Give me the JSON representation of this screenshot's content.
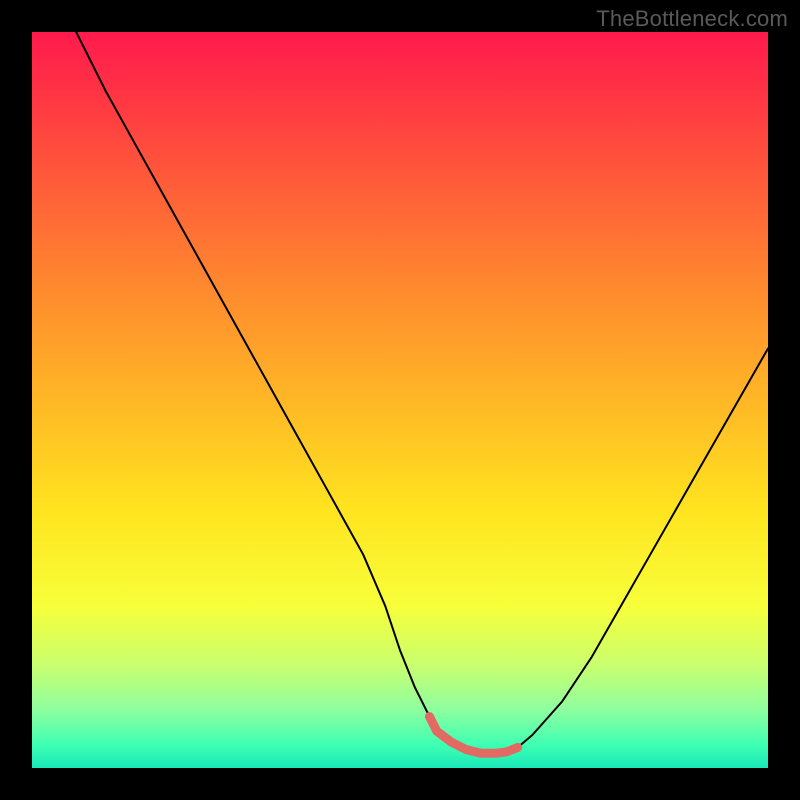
{
  "watermark": "TheBottleneck.com",
  "chart_data": {
    "type": "line",
    "title": "",
    "xlabel": "",
    "ylabel": "",
    "xlim": [
      0,
      100
    ],
    "ylim": [
      0,
      100
    ],
    "series": [
      {
        "name": "main-curve",
        "color": "#000000",
        "x": [
          6,
          10,
          15,
          20,
          25,
          30,
          35,
          40,
          45,
          48,
          50,
          52,
          54,
          55,
          57,
          59,
          61,
          63,
          64.5,
          66,
          68,
          72,
          76,
          80,
          84,
          88,
          92,
          96,
          100
        ],
        "values": [
          100,
          92,
          83,
          74,
          65,
          56,
          47,
          38,
          29,
          22,
          16,
          11,
          7,
          5,
          3.5,
          2.5,
          2,
          2,
          2.2,
          2.8,
          4.5,
          9,
          15,
          22,
          29,
          36,
          43,
          50,
          57
        ]
      },
      {
        "name": "highlight-band",
        "color": "#e26a63",
        "x": [
          54,
          55,
          57,
          59,
          61,
          63,
          64.5,
          66
        ],
        "values": [
          7,
          5,
          3.5,
          2.5,
          2,
          2,
          2.2,
          2.8
        ]
      }
    ],
    "gradient_stops": [
      {
        "pos": 0,
        "color": "#ff1a4d"
      },
      {
        "pos": 8,
        "color": "#ff3344"
      },
      {
        "pos": 20,
        "color": "#ff5a3a"
      },
      {
        "pos": 35,
        "color": "#ff8a2e"
      },
      {
        "pos": 50,
        "color": "#ffb726"
      },
      {
        "pos": 65,
        "color": "#ffe41f"
      },
      {
        "pos": 78,
        "color": "#f7ff3a"
      },
      {
        "pos": 86,
        "color": "#c9ff6e"
      },
      {
        "pos": 92,
        "color": "#8fff9f"
      },
      {
        "pos": 97,
        "color": "#3cffb3"
      },
      {
        "pos": 100,
        "color": "#19e8b8"
      }
    ]
  }
}
